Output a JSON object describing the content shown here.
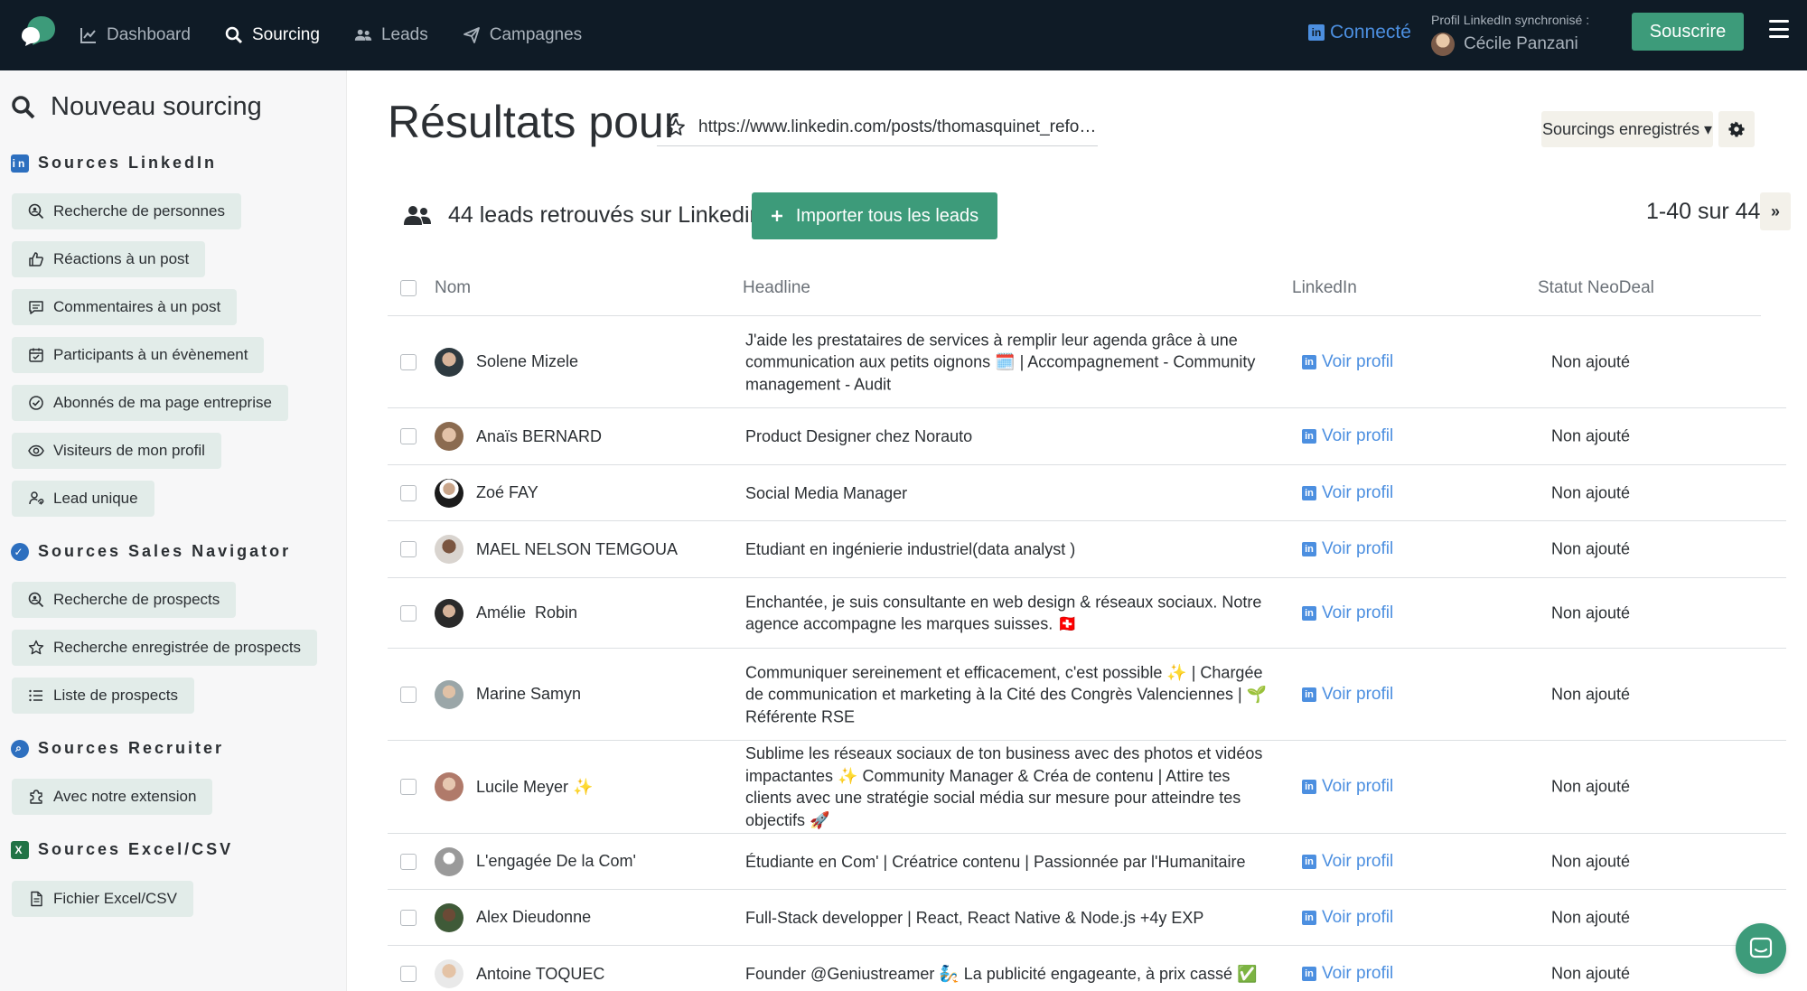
{
  "topbar": {
    "nav": [
      {
        "label": "Dashboard",
        "icon": "chart-line-icon",
        "active": false
      },
      {
        "label": "Sourcing",
        "icon": "search-icon",
        "active": true
      },
      {
        "label": "Leads",
        "icon": "users-icon",
        "active": false
      },
      {
        "label": "Campagnes",
        "icon": "paper-plane-icon",
        "active": false
      }
    ],
    "connected_label": "Connecté",
    "sync_label": "Profil LinkedIn synchronisé :",
    "sync_user": "Cécile Panzani",
    "subscribe_label": "Souscrire"
  },
  "sidebar": {
    "title": "Nouveau sourcing",
    "sections": [
      {
        "title": "Sources LinkedIn",
        "items": [
          "Recherche de personnes",
          "Réactions à un post",
          "Commentaires à un post",
          "Participants à un évènement",
          "Abonnés de ma page entreprise",
          "Visiteurs de mon profil",
          "Lead unique"
        ]
      },
      {
        "title": "Sources Sales Navigator",
        "items": [
          "Recherche de prospects",
          "Recherche enregistrée de prospects",
          "Liste de prospects"
        ]
      },
      {
        "title": "Sources Recruiter",
        "items": [
          "Avec notre extension"
        ]
      },
      {
        "title": "Sources Excel/CSV",
        "items": [
          "Fichier Excel/CSV"
        ]
      }
    ]
  },
  "main": {
    "title": "Résultats pour",
    "url": "https://www.linkedin.com/posts/thomasquinet_refon...",
    "saved_label": "Sourcings enregistrés ▾",
    "leads_found": "44 leads retrouvés sur Linkedin",
    "import_label": "Importer tous les leads",
    "pagination": "1-40 sur 44",
    "next_label": "»"
  },
  "table": {
    "headers": {
      "name": "Nom",
      "headline": "Headline",
      "linkedin": "LinkedIn",
      "status": "Statut NeoDeal"
    },
    "link_label": "Voir profil",
    "rows": [
      {
        "name": "Solene Mizele",
        "headline": "J'aide les prestataires de services à remplir leur agenda grâce à une communication aux petits oignons 🗓️ | Accompagnement - Community management - Audit",
        "status": "Non ajouté"
      },
      {
        "name": "Anaïs BERNARD",
        "headline": "Product Designer chez Norauto",
        "status": "Non ajouté"
      },
      {
        "name": "Zoé FAY",
        "headline": "Social Media Manager",
        "status": "Non ajouté"
      },
      {
        "name": "MAEL NELSON TEMGOUA",
        "headline": "Etudiant en ingénierie industriel(data analyst )",
        "status": "Non ajouté"
      },
      {
        "name": "Amélie  Robin",
        "headline": "Enchantée, je suis consultante en web design & réseaux sociaux. Notre agence accompagne les marques suisses. 🇨🇭",
        "status": "Non ajouté"
      },
      {
        "name": "Marine Samyn",
        "headline": "Communiquer sereinement et efficacement, c'est possible ✨ | Chargée de communication et marketing à la Cité des Congrès Valenciennes | 🌱 Référente RSE",
        "status": "Non ajouté"
      },
      {
        "name": "Lucile Meyer ✨",
        "headline": "Sublime les réseaux sociaux de ton business avec des photos et vidéos impactantes ✨ Community Manager & Créa de contenu | Attire tes clients avec une stratégie social média sur mesure pour atteindre tes objectifs 🚀",
        "status": "Non ajouté"
      },
      {
        "name": "L'engagée De la Com'",
        "headline": "Étudiante en Com' | Créatrice contenu | Passionnée par l'Humanitaire",
        "status": "Non ajouté"
      },
      {
        "name": "Alex Dieudonne",
        "headline": "Full-Stack developper | React, React Native & Node.js +4y EXP",
        "status": "Non ajouté"
      },
      {
        "name": "Antoine TOQUEC",
        "headline": "Founder @Geniustreamer 🧞 La publicité engageante, à prix cassé ✅",
        "status": "Non ajouté"
      }
    ]
  }
}
